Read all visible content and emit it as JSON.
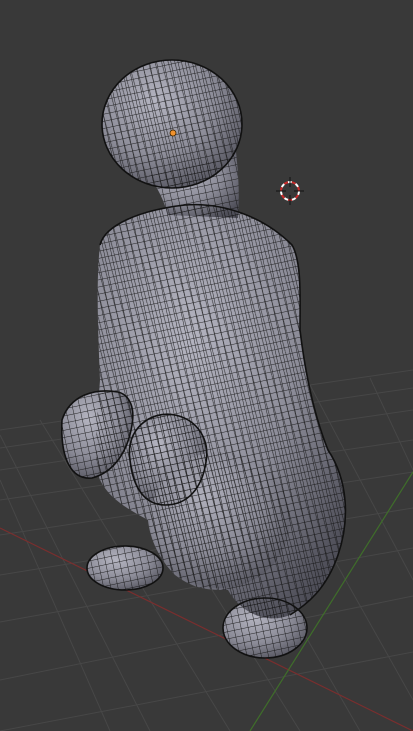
{
  "viewport": {
    "background": "#393939",
    "grid_color": "#474747",
    "x_axis_color": "#7a2e2e",
    "y_axis_color": "#3f6e2a"
  },
  "object": {
    "kind": "sculpted character mesh (wireframe overlay)",
    "surface_color": "#8d8d99",
    "wire_color": "#141414",
    "origin_color": "#f0922e"
  },
  "cursor": {
    "icon": "3d-cursor-icon",
    "ring_color_a": "#cc2a2a",
    "ring_color_b": "#ffffff",
    "crosshair_color": "#111111"
  }
}
